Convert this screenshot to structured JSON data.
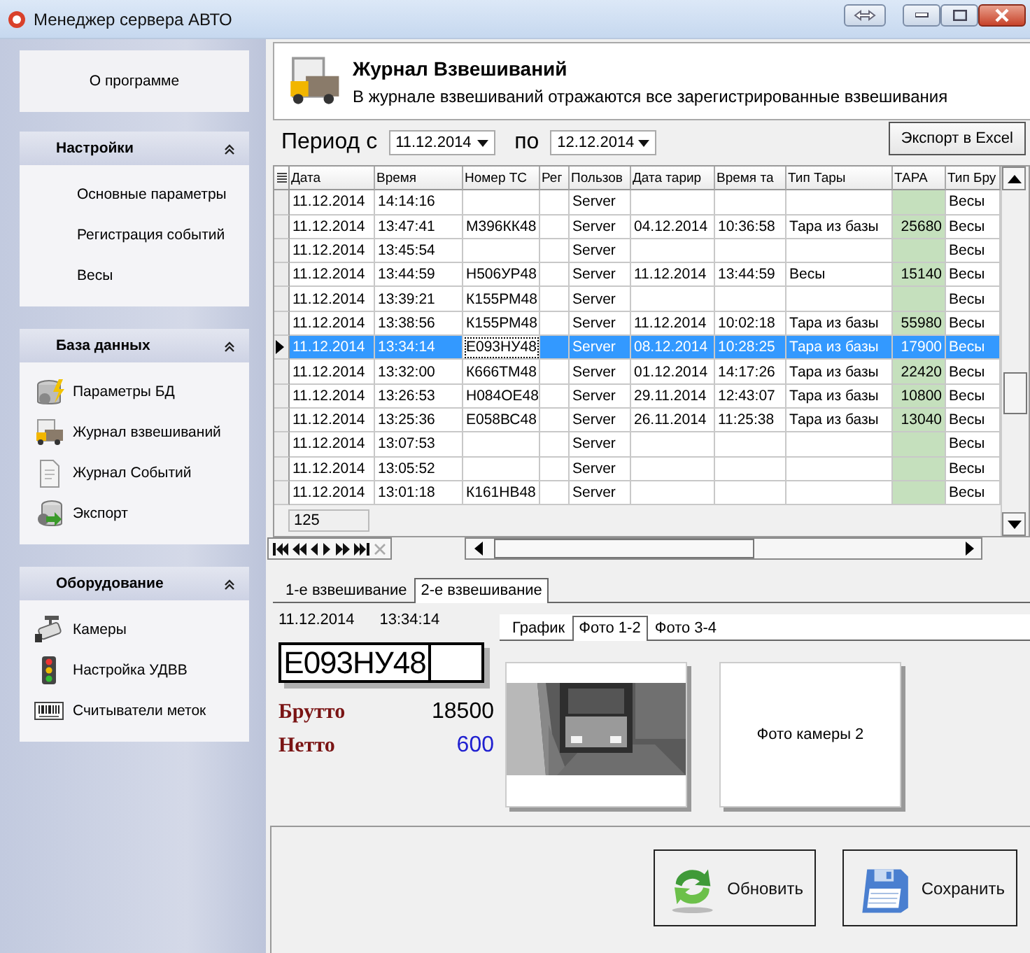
{
  "window": {
    "title": "Менеджер сервера АВТО"
  },
  "sidebar": {
    "about": "О программе",
    "groups": [
      {
        "title": "Настройки",
        "expanded": true,
        "items": [
          {
            "label": "Основные параметры",
            "kind": "plain"
          },
          {
            "label": "Регистрация событий",
            "kind": "plain"
          },
          {
            "label": "Весы",
            "kind": "plain"
          }
        ]
      },
      {
        "title": "База данных",
        "expanded": true,
        "items": [
          {
            "label": "Параметры БД",
            "kind": "database"
          },
          {
            "label": "Журнал взвешиваний",
            "kind": "journal"
          },
          {
            "label": "Журнал Событий",
            "kind": "document"
          },
          {
            "label": "Экспорт",
            "kind": "export"
          }
        ]
      },
      {
        "title": "Оборудование",
        "expanded": true,
        "items": [
          {
            "label": "Камеры",
            "kind": "camera"
          },
          {
            "label": "Настройка УДВВ",
            "kind": "signal"
          },
          {
            "label": "Считыватели меток",
            "kind": "barcode"
          }
        ]
      }
    ]
  },
  "header": {
    "title": "Журнал Взвешиваний",
    "subtitle": "В журнале взвешиваний отражаются все зарегистрированные взвешивания"
  },
  "period": {
    "from_label": "Период с",
    "from": "11.12.2014",
    "to_label": "по",
    "to": "12.12.2014"
  },
  "export_button": "Экспорт в Excel",
  "table": {
    "columns": [
      {
        "label": "Дата",
        "shaded": false
      },
      {
        "label": "Время",
        "shaded": false
      },
      {
        "label": "Номер ТС",
        "shaded": false
      },
      {
        "label": "Рег",
        "shaded": false
      },
      {
        "label": "Пользов",
        "shaded": false
      },
      {
        "label": "Дата тарир",
        "shaded": false
      },
      {
        "label": "Время та",
        "shaded": false
      },
      {
        "label": "Тип Тары",
        "shaded": false
      },
      {
        "label": "ТАРА",
        "shaded": true
      },
      {
        "label": "Тип Бру",
        "shaded": false
      }
    ],
    "rows": [
      {
        "selected": false,
        "cells": [
          "11.12.2014",
          "14:14:16",
          "",
          "",
          "Server",
          "",
          "",
          "",
          "",
          "Весы"
        ]
      },
      {
        "selected": false,
        "cells": [
          "11.12.2014",
          "13:47:41",
          "М396КК48",
          "",
          "Server",
          "04.12.2014",
          "10:36:58",
          "Тара из базы",
          "25680",
          "Весы"
        ]
      },
      {
        "selected": false,
        "cells": [
          "11.12.2014",
          "13:45:54",
          "",
          "",
          "Server",
          "",
          "",
          "",
          "",
          "Весы"
        ]
      },
      {
        "selected": false,
        "cells": [
          "11.12.2014",
          "13:44:59",
          "Н506УР48",
          "",
          "Server",
          "11.12.2014",
          "13:44:59",
          "Весы",
          "15140",
          "Весы"
        ]
      },
      {
        "selected": false,
        "cells": [
          "11.12.2014",
          "13:39:21",
          "К155РМ48",
          "",
          "Server",
          "",
          "",
          "",
          "",
          "Весы"
        ]
      },
      {
        "selected": false,
        "cells": [
          "11.12.2014",
          "13:38:56",
          "К155РМ48",
          "",
          "Server",
          "11.12.2014",
          "10:02:18",
          "Тара из базы",
          "55980",
          "Весы"
        ]
      },
      {
        "selected": true,
        "cells": [
          "11.12.2014",
          "13:34:14",
          "Е093НУ48",
          "",
          "Server",
          "08.12.2014",
          "10:28:25",
          "Тара из базы",
          "17900",
          "Весы"
        ]
      },
      {
        "selected": false,
        "cells": [
          "11.12.2014",
          "13:32:00",
          "К666ТМ48",
          "",
          "Server",
          "01.12.2014",
          "14:17:26",
          "Тара из базы",
          "22420",
          "Весы"
        ]
      },
      {
        "selected": false,
        "cells": [
          "11.12.2014",
          "13:26:53",
          "Н084ОЕ48",
          "",
          "Server",
          "29.11.2014",
          "12:43:07",
          "Тара из базы",
          "10800",
          "Весы"
        ]
      },
      {
        "selected": false,
        "cells": [
          "11.12.2014",
          "13:25:36",
          "Е058ВС48",
          "",
          "Server",
          "26.11.2014",
          "11:25:38",
          "Тара из базы",
          "13040",
          "Весы"
        ]
      },
      {
        "selected": false,
        "cells": [
          "11.12.2014",
          "13:07:53",
          "",
          "",
          "Server",
          "",
          "",
          "",
          "",
          "Весы"
        ]
      },
      {
        "selected": false,
        "cells": [
          "11.12.2014",
          "13:05:52",
          "",
          "",
          "Server",
          "",
          "",
          "",
          "",
          "Весы"
        ]
      },
      {
        "selected": false,
        "cells": [
          "11.12.2014",
          "13:01:18",
          "К161НВ48",
          "",
          "Server",
          "",
          "",
          "",
          "",
          "Весы"
        ]
      }
    ],
    "count": "125"
  },
  "detail_tabs": [
    {
      "label": "1-е взвешивание",
      "selected": false
    },
    {
      "label": "2-е взвешивание",
      "selected": true
    }
  ],
  "weighing": {
    "date": "11.12.2014",
    "time": "13:34:14",
    "plate": "Е093НУ48",
    "brutto_label": "Брутто",
    "brutto": "18500",
    "netto_label": "Нетто",
    "netto": "600"
  },
  "photo_tabs": [
    {
      "label": "График",
      "selected": false
    },
    {
      "label": "Фото 1-2",
      "selected": true
    },
    {
      "label": "Фото 3-4",
      "selected": false
    }
  ],
  "photos": [
    {
      "kind": "picture"
    },
    {
      "kind": "empty",
      "caption": "Фото камеры 2"
    }
  ],
  "buttons": [
    {
      "label": "Обновить",
      "kind": "refresh"
    },
    {
      "label": "Сохранить",
      "kind": "save"
    }
  ]
}
